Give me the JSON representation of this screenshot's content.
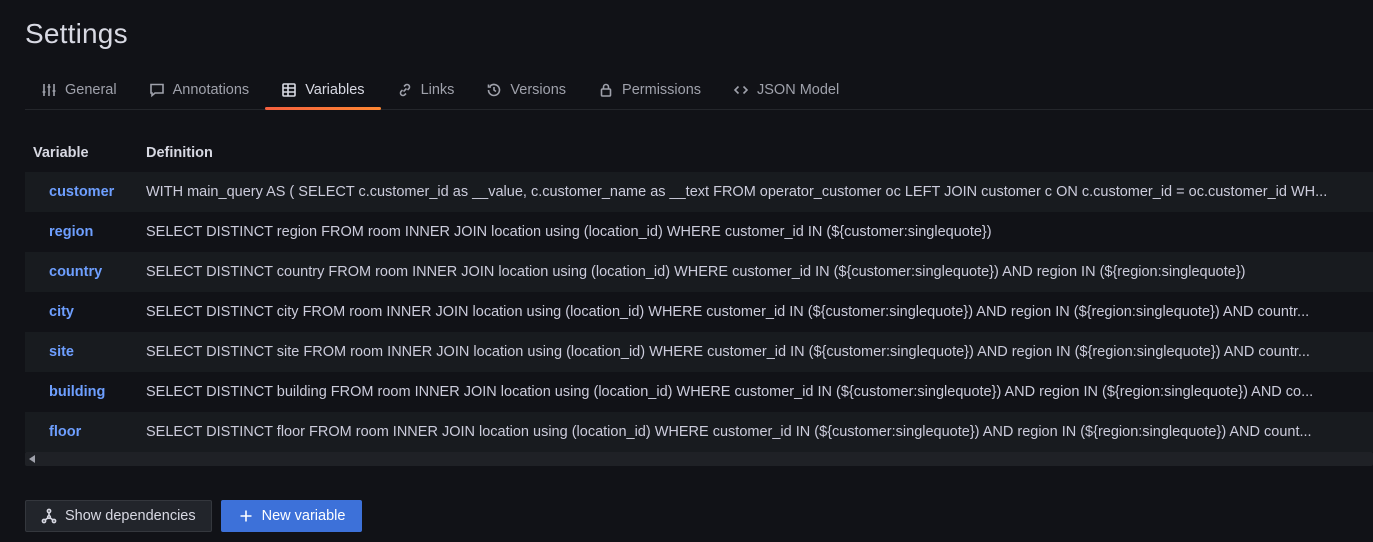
{
  "page": {
    "title": "Settings"
  },
  "tabs": [
    {
      "label": "General",
      "icon": "sliders-icon"
    },
    {
      "label": "Annotations",
      "icon": "comment-icon"
    },
    {
      "label": "Variables",
      "icon": "table-icon",
      "active": true
    },
    {
      "label": "Links",
      "icon": "link-icon"
    },
    {
      "label": "Versions",
      "icon": "history-icon"
    },
    {
      "label": "Permissions",
      "icon": "lock-icon"
    },
    {
      "label": "JSON Model",
      "icon": "code-icon"
    }
  ],
  "table": {
    "headers": {
      "variable": "Variable",
      "definition": "Definition"
    },
    "rows": [
      {
        "name": "customer",
        "definition": "WITH main_query AS ( SELECT c.customer_id as __value, c.customer_name as __text FROM operator_customer oc LEFT JOIN customer c ON c.customer_id = oc.customer_id WH..."
      },
      {
        "name": "region",
        "definition": "SELECT DISTINCT region FROM room INNER JOIN location using (location_id) WHERE customer_id IN (${customer:singlequote})"
      },
      {
        "name": "country",
        "definition": "SELECT DISTINCT country FROM room INNER JOIN location using (location_id) WHERE customer_id IN (${customer:singlequote}) AND region IN (${region:singlequote})"
      },
      {
        "name": "city",
        "definition": "SELECT DISTINCT city FROM room INNER JOIN location using (location_id) WHERE customer_id IN (${customer:singlequote}) AND region IN (${region:singlequote}) AND countr..."
      },
      {
        "name": "site",
        "definition": "SELECT DISTINCT site FROM room INNER JOIN location using (location_id) WHERE customer_id IN (${customer:singlequote}) AND region IN (${region:singlequote}) AND countr..."
      },
      {
        "name": "building",
        "definition": "SELECT DISTINCT building FROM room INNER JOIN location using (location_id) WHERE customer_id IN (${customer:singlequote}) AND region IN (${region:singlequote}) AND co..."
      },
      {
        "name": "floor",
        "definition": "SELECT DISTINCT floor FROM room INNER JOIN location using (location_id) WHERE customer_id IN (${customer:singlequote}) AND region IN (${region:singlequote}) AND count..."
      }
    ]
  },
  "actions": {
    "show_dependencies": "Show dependencies",
    "new_variable": "New variable"
  },
  "colors": {
    "background": "#111217",
    "accent_tab": "#f55f3e",
    "variable_link": "#6e9fff",
    "primary_button": "#3d71d9"
  }
}
